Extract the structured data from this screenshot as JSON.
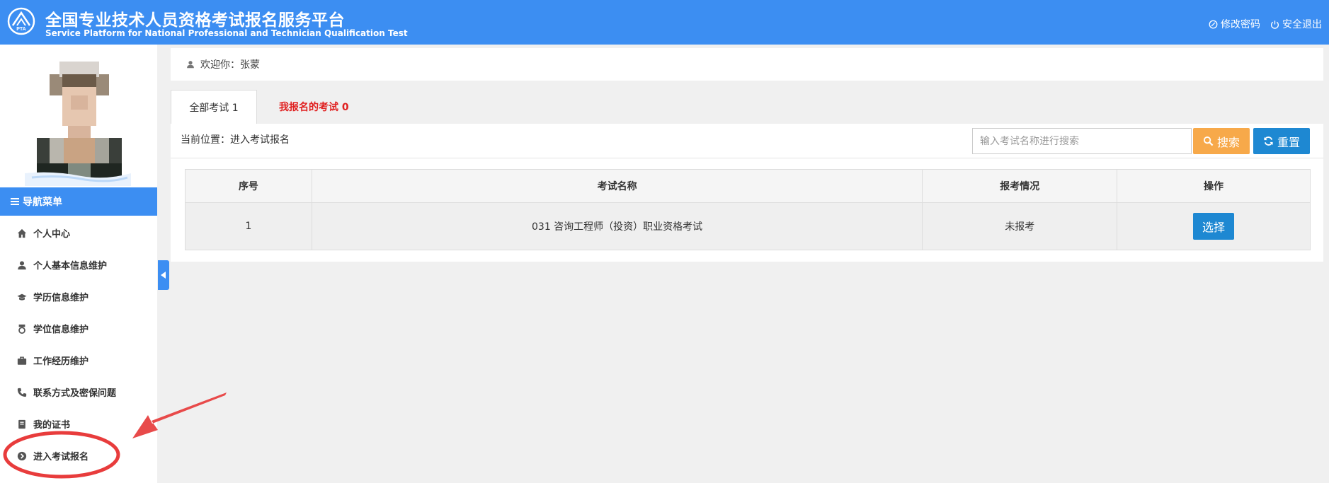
{
  "header": {
    "title_cn": "全国专业技术人员资格考试报名服务平台",
    "title_en": "Service Platform for National Professional and Technician Qualification Test",
    "logo_text": "PTA",
    "change_password": "修改密码",
    "logout": "安全退出",
    "color": "#3c8ef2"
  },
  "sidebar": {
    "nav_title": "导航菜单",
    "items": [
      {
        "label": "个人中心",
        "icon": "home-icon"
      },
      {
        "label": "个人基本信息维护",
        "icon": "user-icon"
      },
      {
        "label": "学历信息维护",
        "icon": "graduation-cap-icon"
      },
      {
        "label": "学位信息维护",
        "icon": "medal-icon"
      },
      {
        "label": "工作经历维护",
        "icon": "briefcase-icon"
      },
      {
        "label": "联系方式及密保问题",
        "icon": "phone-icon"
      },
      {
        "label": "我的证书",
        "icon": "book-icon"
      },
      {
        "label": "进入考试报名",
        "icon": "chevron-circle-icon"
      }
    ]
  },
  "welcome": "欢迎你：张蒙",
  "tabs": [
    {
      "label": "全部考试 1",
      "active": true
    },
    {
      "label": "我报名的考试 0",
      "active": false,
      "color": "#e02020"
    }
  ],
  "breadcrumb": "当前位置：进入考试报名",
  "search": {
    "placeholder": "输入考试名称进行搜索",
    "search_label": "搜索",
    "reset_label": "重置",
    "search_color": "#f7a94a",
    "reset_color": "#1e88d2"
  },
  "table": {
    "headers": [
      "序号",
      "考试名称",
      "报考情况",
      "操作"
    ],
    "rows": [
      {
        "index": "1",
        "name": "031 咨询工程师（投资）职业资格考试",
        "status": "未报考",
        "action": "选择"
      }
    ]
  }
}
